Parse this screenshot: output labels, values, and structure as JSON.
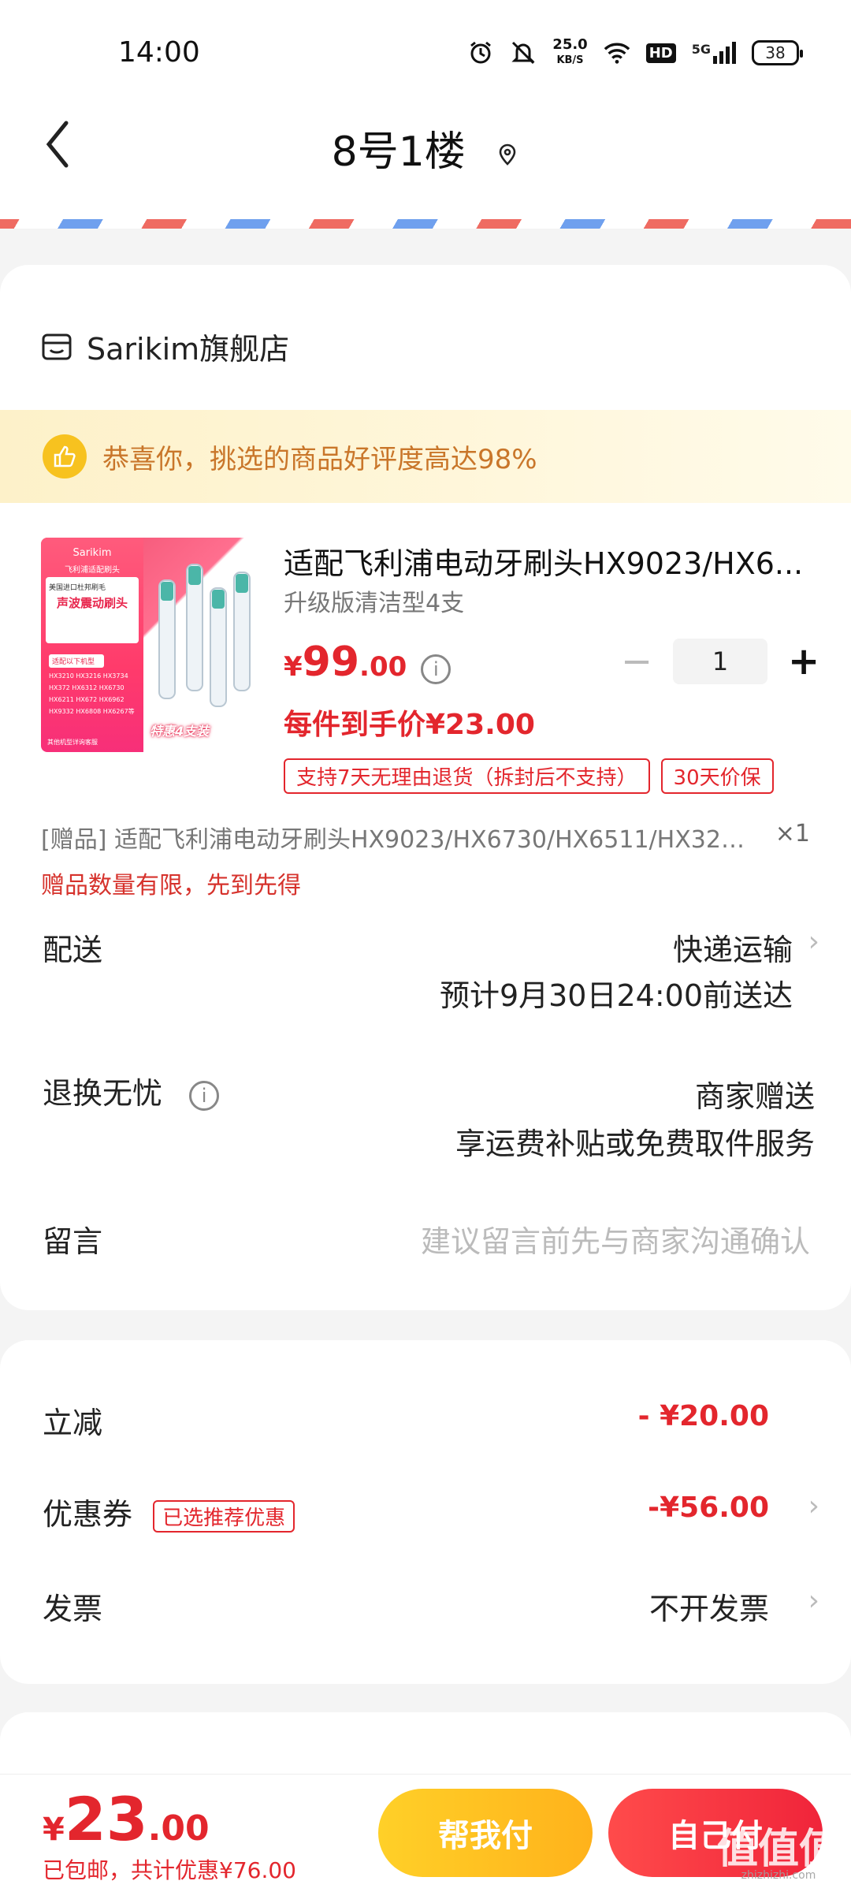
{
  "status": {
    "time": "14:00",
    "speed_top": "25.0",
    "speed_unit": "KB/S",
    "hd": "HD",
    "network": "5G",
    "battery": "38"
  },
  "header": {
    "title": "8号1楼"
  },
  "store": {
    "name": "Sarikim旗舰店"
  },
  "praise": {
    "text": "恭喜你，挑选的商品好评度高达98%"
  },
  "product": {
    "title": "适配飞利浦电动牙刷头HX9023/HX6...",
    "spec": "升级版清洁型4支",
    "price_symbol": "¥",
    "price_int": "99",
    "price_dec": ".00",
    "quantity": "1",
    "unit_price": "每件到手价¥23.00",
    "tags": [
      "支持7天无理由退货（拆封后不支持）",
      "30天价保"
    ],
    "image_texts": {
      "brand": "Sarikim",
      "line1": "飞利浦适配刷头",
      "line2": "美国进口杜邦刷毛",
      "headline": "声波震动刷头",
      "fits": "适配以下机型",
      "models": "HX3210 HX3216 HX3734 HX372 HX6312 HX6730 HX6211 HX672 HX6962 HX9332 HX6808 HX6267等",
      "more": "其他机型详询客服",
      "promo": "特惠4支装"
    }
  },
  "gift": {
    "text": "[赠品] 适配飞利浦电动牙刷头HX9023/HX6730/HX6511/HX3226等...",
    "qty": "×1",
    "note": "赠品数量有限，先到先得"
  },
  "delivery": {
    "label": "配送",
    "method": "快递运输",
    "eta": "预计9月30日24:00前送达"
  },
  "returns": {
    "label": "退换无忧",
    "line1": "商家赠送",
    "line2": "享运费补贴或免费取件服务"
  },
  "message": {
    "label": "留言",
    "placeholder": "建议留言前先与商家沟通确认"
  },
  "fees": {
    "discount_label": "立减",
    "discount_value": "- ¥20.00",
    "coupon_label": "优惠券",
    "coupon_badge": "已选推荐优惠",
    "coupon_value": "-¥56.00",
    "invoice_label": "发票",
    "invoice_value": "不开发票"
  },
  "bottom": {
    "total_symbol": "¥",
    "total_int": "23",
    "total_dec": ".00",
    "sub": "已包邮，共计优惠¥76.00",
    "help_pay": "帮我付",
    "self_pay": "自己付"
  },
  "watermark": {
    "main": "值值值",
    "sub": "zhizhizhi.com"
  },
  "colors": {
    "accent_red": "#e3262d",
    "help_yellow": "#ffc024",
    "praise_text": "#c9762a"
  }
}
